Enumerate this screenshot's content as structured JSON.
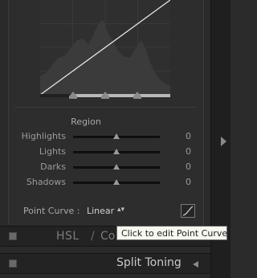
{
  "tone_curve": {
    "region": {
      "title": "Region",
      "sliders": [
        {
          "label": "Highlights",
          "value": "0",
          "position": 0.5
        },
        {
          "label": "Lights",
          "value": "0",
          "position": 0.5
        },
        {
          "label": "Darks",
          "value": "0",
          "position": 0.5
        },
        {
          "label": "Shadows",
          "value": "0",
          "position": 0.5
        }
      ]
    },
    "point_curve": {
      "label": "Point Curve :",
      "value": "Linear",
      "arrows": "▴▾",
      "edit_icon": "curve-edit-icon"
    }
  },
  "sections": {
    "hsl": {
      "label": "HSL",
      "separator": "/",
      "color_label": "Co"
    },
    "split_toning": {
      "label": "Split Toning"
    }
  },
  "tooltip": {
    "text": "Click to edit Point Curve"
  },
  "icons": [
    "panel-toggle-icon",
    "collapse-arrow-icon",
    "right-panel-arrow-icon"
  ]
}
